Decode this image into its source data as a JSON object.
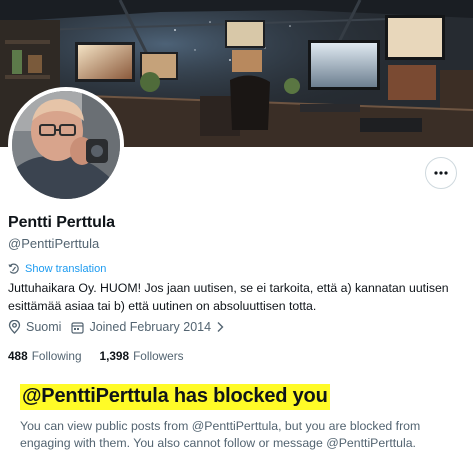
{
  "profile": {
    "display_name": "Pentti Perttula",
    "handle": "@PenttiPerttula",
    "show_translation": "Show translation",
    "bio": "Juttuhaikara Oy. HUOM! Jos jaan uutisen, se ei tarkoita, että a) kannatan uutisen esittämää asiaa tai b) että uutinen on absoluuttisen totta.",
    "location": "Suomi",
    "joined": "Joined February 2014",
    "following_count": "488",
    "following_label": "Following",
    "followers_count": "1,398",
    "followers_label": "Followers"
  },
  "blocked": {
    "title": "@PenttiPerttula has blocked you",
    "description": "You can view public posts from @PenttiPerttula, but you are blocked from engaging with them. You also cannot follow or message @PenttiPerttula."
  },
  "icons": {
    "more": "more-horizontal-icon",
    "translate": "translate-icon",
    "location": "location-pin-icon",
    "calendar": "calendar-icon",
    "chevron": "chevron-right-icon"
  },
  "colors": {
    "accent": "#1d9bf0",
    "secondary_text": "#536471",
    "highlight": "#fffb27"
  }
}
